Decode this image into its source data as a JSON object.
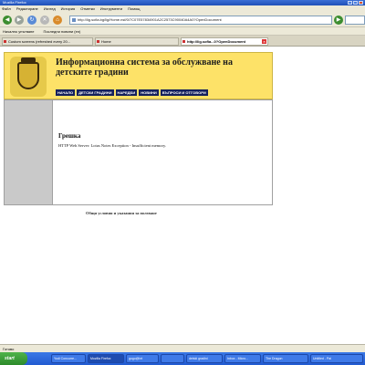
{
  "window": {
    "title": "Mozilla Firefox"
  },
  "menu": [
    "Файл",
    "Редактиране",
    "Изглед",
    "История",
    "Отметки",
    "Инструменти",
    "Помощ"
  ],
  "address": {
    "url": "http://lig.sofia.bg/lig/Home.nsf/0/7C07E57834901A2C2573C90040A4A0?OpenDocument"
  },
  "bookmarks": [
    "Начално упътване",
    "Последни новини (en)"
  ],
  "tabs": [
    {
      "label": "Custom screens (refreshed every 20...",
      "active": false
    },
    {
      "label": "Home",
      "active": false
    },
    {
      "label": "http://lig.sofia...0?OpenDocument",
      "active": true
    }
  ],
  "site": {
    "title": "Информационна система за обслужване на детските градини",
    "nav": [
      "НАЧАЛО",
      "ДЕТСКИ ГРАДИНИ",
      "НАРЕДБИ",
      "НОВИНИ",
      "ВЪПРОСИ И ОТГОВОРИ"
    ],
    "error_title": "Грешка",
    "error_message": "HTTP Web Server: Lotus Notes Exception - Insufficient memory.",
    "footer_link": "Общи условия и указания за ползване"
  },
  "status": {
    "text": "Готово"
  },
  "taskbar": {
    "start": "start",
    "tasks": [
      "Yodi Concurre...",
      "Mozilla Firefox",
      "gogo@int",
      "",
      "detski gradini",
      "Inbox - Micro...",
      "The Dragon",
      "Untitled - Pai"
    ]
  },
  "colors": {
    "header_bg": "#fde268",
    "nav_bg": "#14205c",
    "sidebar_bg": "#c9c9c9",
    "chrome_bg": "#ece9d8",
    "taskbar_bg": "#225bd1"
  }
}
